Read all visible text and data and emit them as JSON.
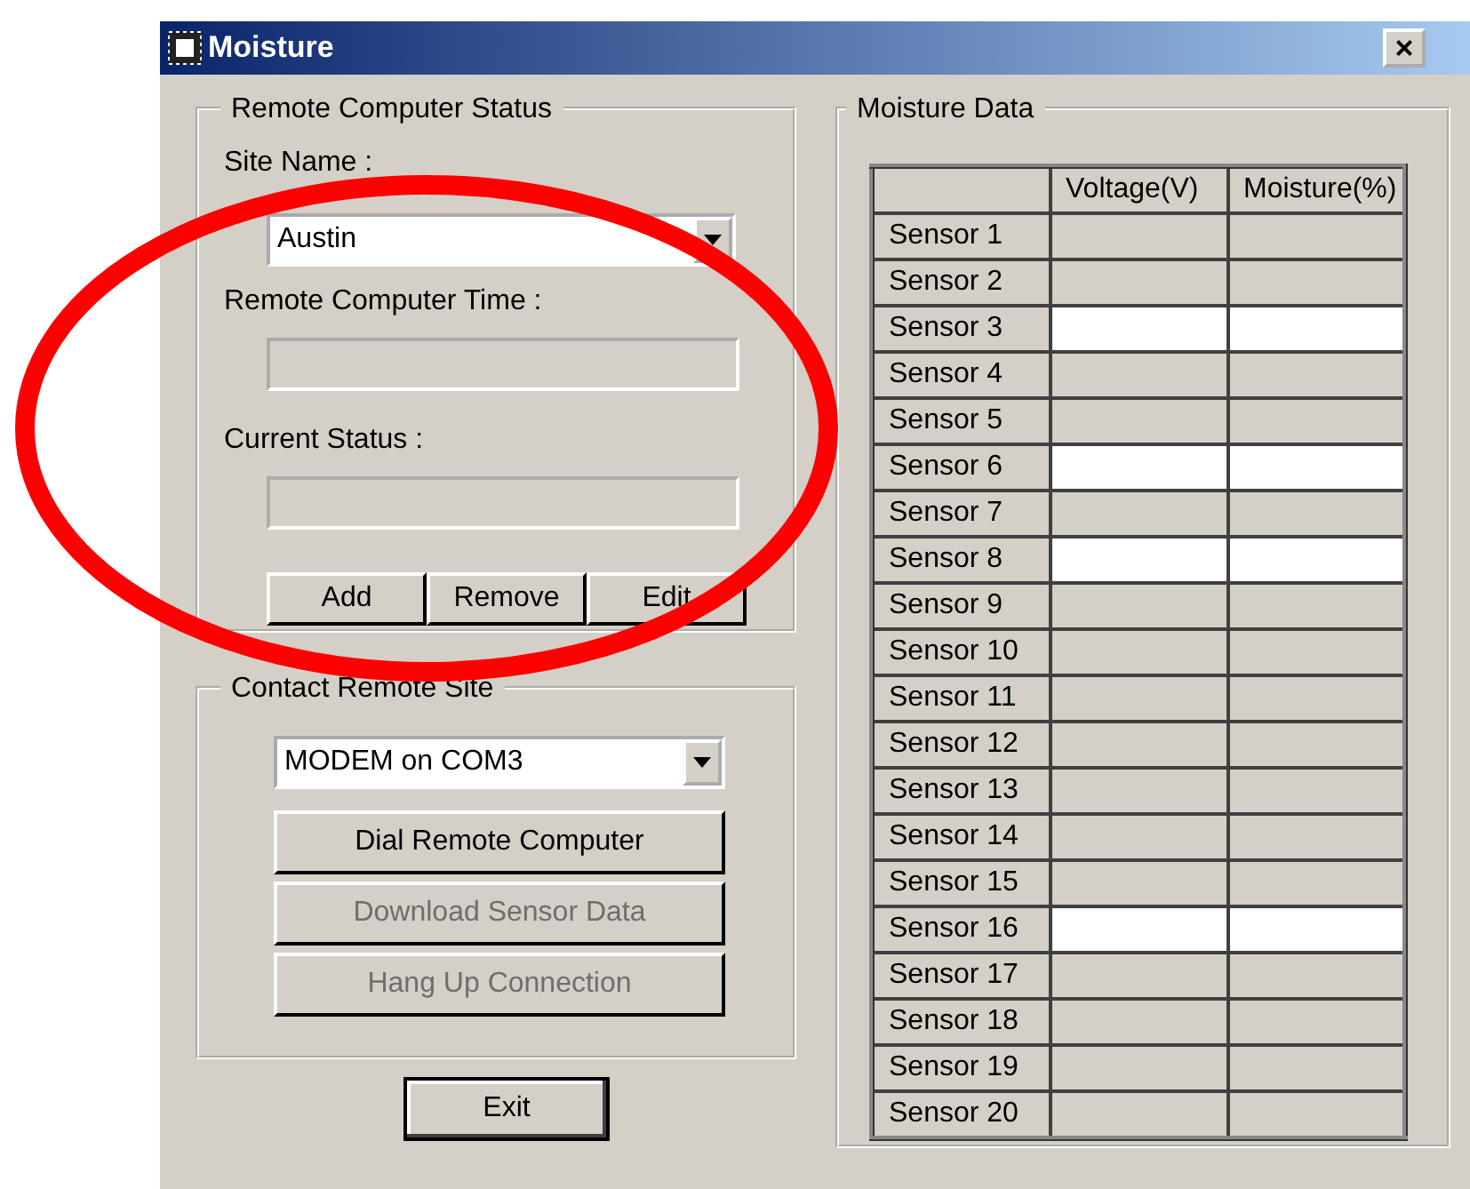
{
  "window": {
    "title": "Moisture",
    "close": "×"
  },
  "remote_status": {
    "legend": "Remote Computer Status",
    "site_label": "Site Name :",
    "site_value": "Austin",
    "time_label": "Remote Computer Time :",
    "status_label": "Current Status :",
    "buttons": [
      {
        "label": "Add",
        "disabled": false
      },
      {
        "label": "Remove",
        "disabled": false
      },
      {
        "label": "Edit",
        "disabled": false
      }
    ]
  },
  "contact": {
    "legend": "Contact Remote Site",
    "port_value": "MODEM on COM3",
    "buttons": [
      {
        "label": "Dial Remote Computer",
        "disabled": false
      },
      {
        "label": "Download Sensor Data",
        "disabled": true
      },
      {
        "label": "Hang Up Connection",
        "disabled": true
      }
    ]
  },
  "exit_button": "Exit",
  "moisture_data": {
    "legend": "Moisture Data",
    "columns": [
      "Voltage(V)",
      "Moisture(%)"
    ],
    "rows": [
      {
        "label": "Sensor 1",
        "selected": false
      },
      {
        "label": "Sensor 2",
        "selected": false
      },
      {
        "label": "Sensor 3",
        "selected": true
      },
      {
        "label": "Sensor 4",
        "selected": false
      },
      {
        "label": "Sensor 5",
        "selected": false
      },
      {
        "label": "Sensor 6",
        "selected": true
      },
      {
        "label": "Sensor 7",
        "selected": false
      },
      {
        "label": "Sensor 8",
        "selected": true
      },
      {
        "label": "Sensor 9",
        "selected": false
      },
      {
        "label": "Sensor 10",
        "selected": false
      },
      {
        "label": "Sensor 11",
        "selected": false
      },
      {
        "label": "Sensor 12",
        "selected": false
      },
      {
        "label": "Sensor 13",
        "selected": false
      },
      {
        "label": "Sensor 14",
        "selected": false
      },
      {
        "label": "Sensor 15",
        "selected": false
      },
      {
        "label": "Sensor 16",
        "selected": true
      },
      {
        "label": "Sensor 17",
        "selected": false
      },
      {
        "label": "Sensor 18",
        "selected": false
      },
      {
        "label": "Sensor 19",
        "selected": false
      },
      {
        "label": "Sensor 20",
        "selected": false
      }
    ]
  },
  "annotation": {
    "kind": "circle",
    "color": "#ff0000"
  }
}
